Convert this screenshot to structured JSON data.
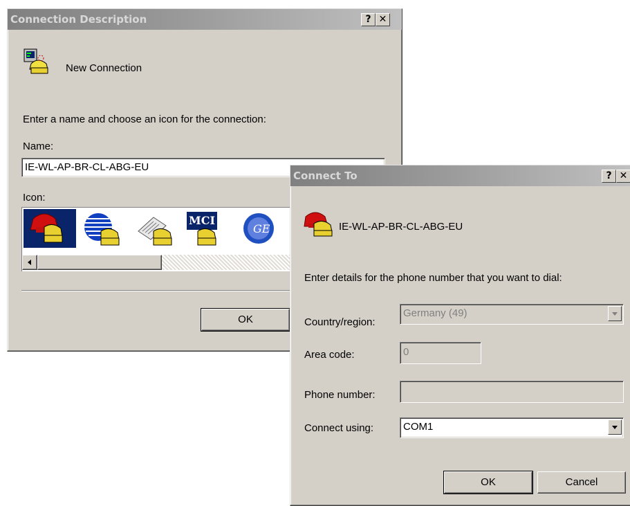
{
  "connection_description": {
    "title": "Connection Description",
    "help_glyph": "?",
    "close_glyph": "✕",
    "connection_label": "New Connection",
    "instruction": "Enter a name and choose an icon for the connection:",
    "name_label": "Name:",
    "name_value": "IE-WL-AP-BR-CL-ABG-EU",
    "icon_label": "Icon:",
    "icons": [
      "red-phone-icon",
      "globe-phone-icon",
      "fax-phone-icon",
      "mci-phone-icon",
      "ge-phone-icon"
    ],
    "mci_text": "MCI",
    "ok_label": "OK"
  },
  "connect_to": {
    "title": "Connect To",
    "help_glyph": "?",
    "close_glyph": "✕",
    "connection_name": "IE-WL-AP-BR-CL-ABG-EU",
    "instruction": "Enter details for the phone number that you want to dial:",
    "country_label": "Country/region:",
    "country_value": "Germany (49)",
    "area_label": "Area code:",
    "area_value": "0",
    "phone_label": "Phone number:",
    "phone_value": "",
    "connect_label": "Connect using:",
    "connect_value": "COM1",
    "ok_label": "OK",
    "cancel_label": "Cancel"
  },
  "colors": {
    "dialog_face": "#d4d0c8",
    "title_inactive": "#808080",
    "selected_icon_bg": "#0a246a"
  }
}
